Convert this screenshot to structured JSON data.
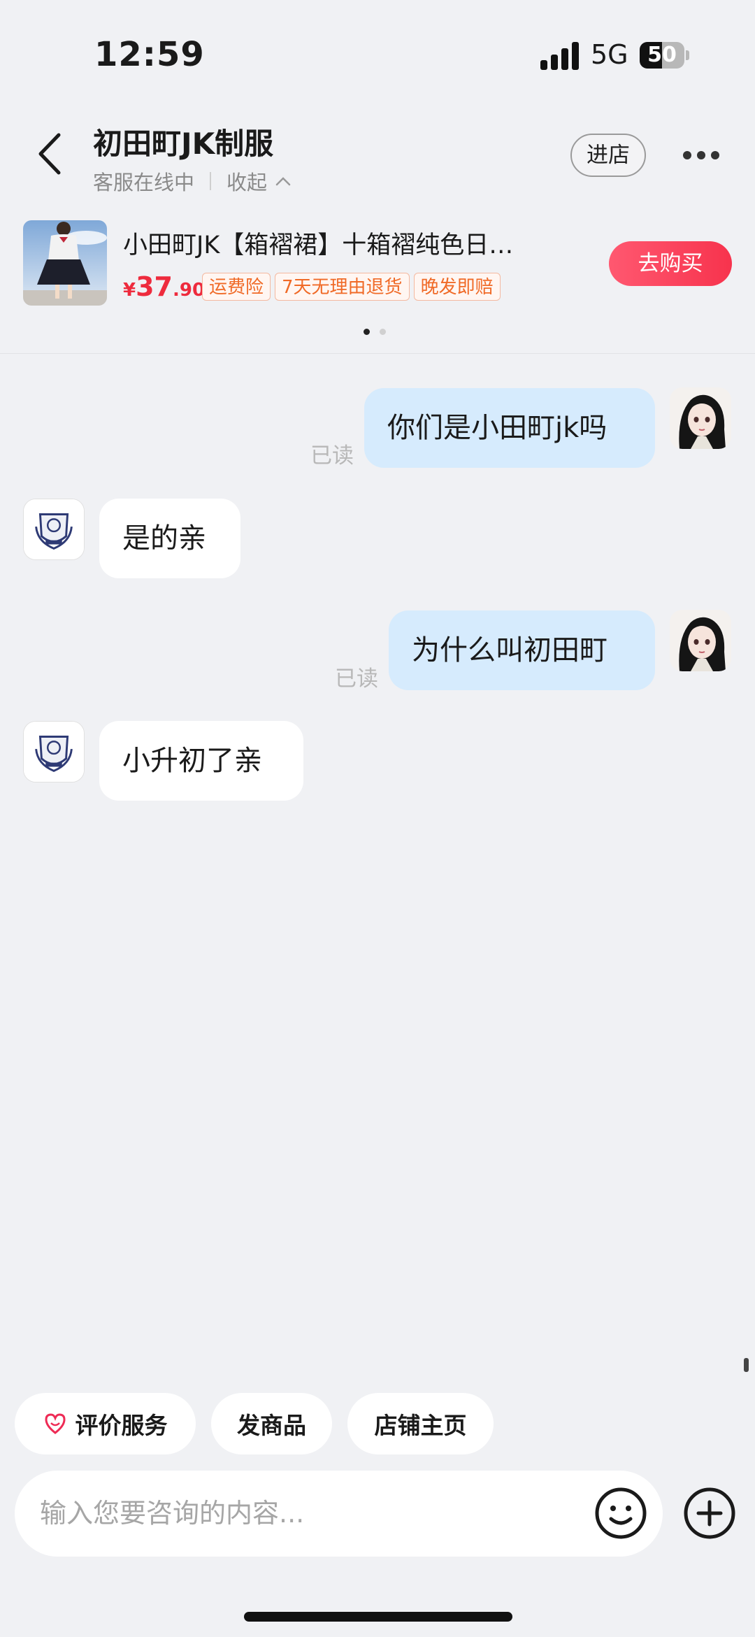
{
  "status_bar": {
    "time": "12:59",
    "network": "5G",
    "battery": "50",
    "battery_level": 0.5
  },
  "header": {
    "title": "初田町JK制服",
    "status": "客服在线中",
    "collapse_label": "收起",
    "enter_store": "进店"
  },
  "product": {
    "title": "小田町JK【箱褶裙】十箱褶纯色日…",
    "currency": "¥",
    "price_int": "37",
    "price_dec": ".90",
    "tags": [
      "运费险",
      "7天无理由退货",
      "晚发即赔"
    ],
    "buy_label": "去购买",
    "page_count": 2,
    "page_active": 1
  },
  "messages": [
    {
      "from": "user",
      "text": "你们是小田町jk吗",
      "status": "已读"
    },
    {
      "from": "shop",
      "text": "是的亲"
    },
    {
      "from": "user",
      "text": "为什么叫初田町",
      "status": "已读"
    },
    {
      "from": "shop",
      "text": "小升初了亲"
    }
  ],
  "quick_actions": [
    "评价服务",
    "发商品",
    "店铺主页"
  ],
  "input": {
    "placeholder": "输入您要咨询的内容..."
  },
  "colors": {
    "accent": "#f7334d",
    "user_bubble": "#d6ebfd",
    "tag": "#f06a27"
  }
}
